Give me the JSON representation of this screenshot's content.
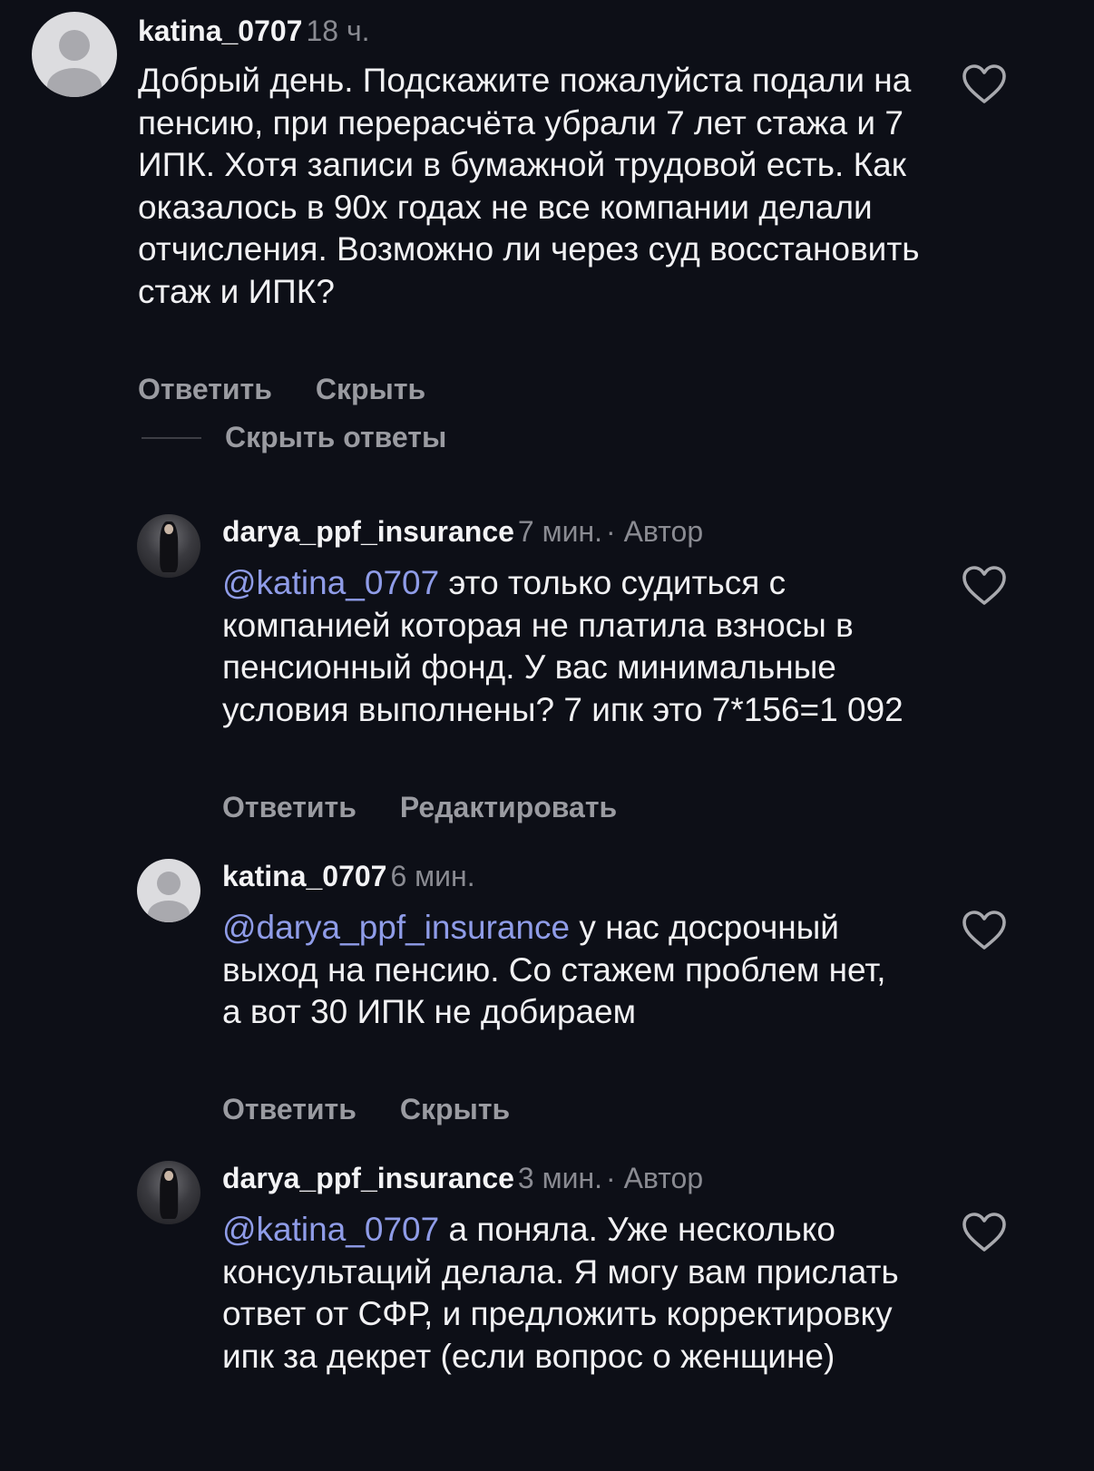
{
  "comments": [
    {
      "username": "katina_0707",
      "time": "18 ч.",
      "author_tag": "",
      "mention": "",
      "text": "Добрый день. Подскажите пожалуйста подали на пенсию, при перерасчёта убрали 7 лет стажа и 7 ИПК.  Хотя записи в бумажной трудовой есть. Как оказалось в 90х годах не все компании делали отчисления. Возможно ли через суд восстановить стаж и ИПК?",
      "actions": [
        "Ответить",
        "Скрыть"
      ]
    },
    {
      "username": "darya_ppf_insurance",
      "time": "7 мин.",
      "author_tag": "· Автор",
      "mention": "@katina_0707",
      "text": "это только судиться с компанией которая не платила взносы в пенсионный фонд. У вас минимальные условия выполнены? 7 ипк это 7*156=1 092",
      "actions": [
        "Ответить",
        "Редактировать"
      ]
    },
    {
      "username": "katina_0707",
      "time": "6 мин.",
      "author_tag": "",
      "mention": "@darya_ppf_insurance",
      "text": "у нас досрочный выход на пенсию. Со стажем проблем нет, а вот 30 ИПК не добираем",
      "actions": [
        "Ответить",
        "Скрыть"
      ]
    },
    {
      "username": "darya_ppf_insurance",
      "time": "3 мин.",
      "author_tag": "· Автор",
      "mention": "@katina_0707",
      "text": "а поняла. Уже несколько консультаций делала. Я могу вам прислать ответ от СФР, и предложить корректировку ипк за декрет (если вопрос о женщине)",
      "actions": []
    }
  ],
  "hide_replies_label": "Скрыть ответы",
  "icons": {
    "like": "heart-outline-icon",
    "default_avatar": "user-silhouette-icon"
  },
  "colors": {
    "background": "#0d0f17",
    "mention": "#8f9ce8",
    "meta": "#8a8b92"
  }
}
